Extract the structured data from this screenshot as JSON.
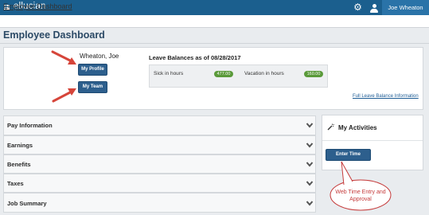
{
  "header": {
    "brand": "ellucian",
    "user_name": "Joe Wheaton",
    "icons": [
      "grid-icon",
      "gear-icon",
      "user-icon"
    ],
    "bar_color": "#1b5f8e"
  },
  "breadcrumb": {
    "label": "Employee Dashboard"
  },
  "page": {
    "title": "Employee Dashboard"
  },
  "profile": {
    "name": "Wheaton, Joe",
    "my_profile_label": "My Profile",
    "my_team_label": "My Team"
  },
  "leave": {
    "title": "Leave Balances as of 08/28/2017",
    "items": [
      {
        "label": "Sick in hours",
        "value": "477.00"
      },
      {
        "label": "Vacation in hours",
        "value": "160.00"
      }
    ],
    "full_link": "Full Leave Balance Information",
    "pill_color": "#5a9a3a"
  },
  "sections": [
    {
      "label": "Pay Information"
    },
    {
      "label": "Earnings"
    },
    {
      "label": "Benefits"
    },
    {
      "label": "Taxes"
    },
    {
      "label": "Job Summary"
    }
  ],
  "activities": {
    "title": "My Activities",
    "enter_time_label": "Enter Time",
    "callout": "Web Time Entry and Approval",
    "callout_color": "#c53a3a"
  }
}
